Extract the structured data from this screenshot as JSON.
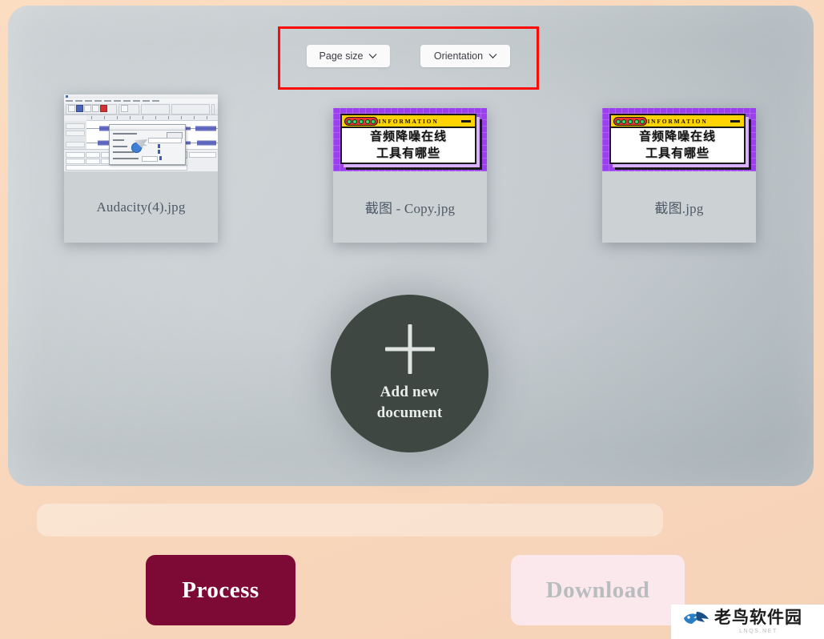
{
  "toolbar": {
    "page_size_label": "Page size",
    "orientation_label": "Orientation",
    "chevron_icon": "chevron-down-icon"
  },
  "annotation": {
    "color": "#fb0b09",
    "shape": "rectangle"
  },
  "documents": [
    {
      "filename": "Audacity(4).jpg",
      "preview_type": "audacity-screenshot"
    },
    {
      "filename": "截图 - Copy.jpg",
      "preview_type": "information-poster",
      "poster": {
        "titlebar_text": "INFORMATION",
        "line1": "音频降噪在线",
        "line2": "工具有哪些"
      }
    },
    {
      "filename": "截图.jpg",
      "preview_type": "information-poster",
      "poster": {
        "titlebar_text": "INFORMATION",
        "line1": "音频降噪在线",
        "line2": "工具有哪些"
      }
    }
  ],
  "add_document": {
    "line1": "Add new",
    "line2": "document",
    "icon": "plus-icon",
    "color": "#3e4741"
  },
  "actions": {
    "process_label": "Process",
    "process_color": "#7c0a34",
    "download_label": "Download",
    "download_color": "#fbe8ec",
    "download_disabled": true
  },
  "watermark": {
    "brand": "老鸟软件园",
    "site": "LNQS.NET",
    "logo_icon": "bird-logo-icon"
  },
  "theme": {
    "page_background": "#fadcc3",
    "workspace_background": "#c6ccd0",
    "card_background": "#ccd1d4"
  }
}
